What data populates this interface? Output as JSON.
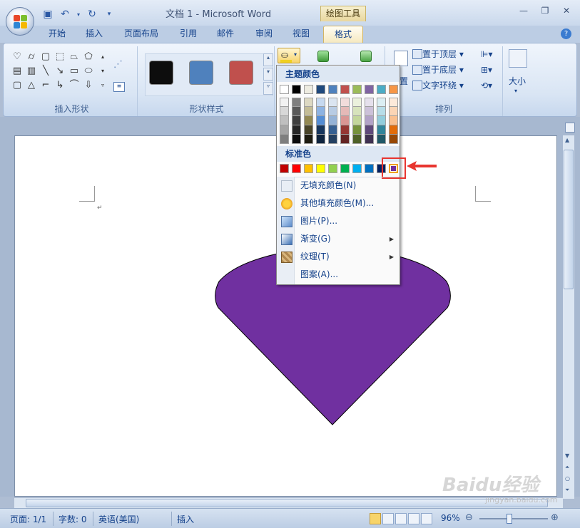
{
  "window": {
    "title": "文档 1 - Microsoft Word",
    "context_tab_group": "绘图工具"
  },
  "qat": {
    "icons": [
      "save-icon",
      "undo-icon",
      "redo-icon",
      "customize-icon"
    ]
  },
  "ribbon_tabs": [
    "开始",
    "插入",
    "页面布局",
    "引用",
    "邮件",
    "审阅",
    "视图",
    "格式"
  ],
  "active_tab": "格式",
  "groups": {
    "insert_shapes": "插入形状",
    "shape_styles": "形状样式",
    "arrange": "排列",
    "size": "大小"
  },
  "shape_style_swatches": [
    "#0d0d0d",
    "#4f81bd",
    "#c0504d"
  ],
  "arrange_items": [
    "置于顶层",
    "置于底层",
    "文字环绕"
  ],
  "arrange_partial_label": "置",
  "fill_dropdown": {
    "theme_colors_header": "主题颜色",
    "standard_colors_header": "标准色",
    "theme_top_row": [
      "#ffffff",
      "#000000",
      "#eeece1",
      "#1f497d",
      "#4f81bd",
      "#c0504d",
      "#9bbb59",
      "#8064a2",
      "#4bacc6",
      "#f79646"
    ],
    "theme_shades": [
      [
        "#f2f2f2",
        "#7f7f7f",
        "#ddd9c3",
        "#c6d9f0",
        "#dbe5f1",
        "#f2dcdb",
        "#ebf1dd",
        "#e5e0ec",
        "#dbeef3",
        "#fdeada"
      ],
      [
        "#d8d8d8",
        "#595959",
        "#c4bd97",
        "#8db3e2",
        "#b8cce4",
        "#e5b9b7",
        "#d7e3bc",
        "#ccc1d9",
        "#b7dde8",
        "#fbd5b5"
      ],
      [
        "#bfbfbf",
        "#3f3f3f",
        "#938953",
        "#548dd4",
        "#95b3d7",
        "#d99694",
        "#c3d69b",
        "#b2a2c7",
        "#92cddc",
        "#fac08f"
      ],
      [
        "#a5a5a5",
        "#262626",
        "#494429",
        "#17365d",
        "#366092",
        "#953734",
        "#76923c",
        "#5f497a",
        "#31859b",
        "#e36c09"
      ],
      [
        "#7f7f7f",
        "#0c0c0c",
        "#1d1b10",
        "#0f243e",
        "#244061",
        "#632423",
        "#4f6128",
        "#3f3151",
        "#205867",
        "#974806"
      ]
    ],
    "standard_colors": [
      "#c00000",
      "#ff0000",
      "#ffc000",
      "#ffff00",
      "#92d050",
      "#00b050",
      "#00b0f0",
      "#0070c0",
      "#002060",
      "#7030a0"
    ],
    "selected_standard_index": 9,
    "menu_items": [
      {
        "label": "无填充颜色(N)",
        "icon": "no-fill-icon",
        "submenu": false
      },
      {
        "label": "其他填充颜色(M)...",
        "icon": "color-palette-icon",
        "submenu": false
      },
      {
        "label": "图片(P)...",
        "icon": "picture-icon",
        "submenu": false
      },
      {
        "label": "渐变(G)",
        "icon": "gradient-icon",
        "submenu": true
      },
      {
        "label": "纹理(T)",
        "icon": "texture-icon",
        "submenu": true
      },
      {
        "label": "图案(A)...",
        "icon": "pattern-icon",
        "submenu": false
      }
    ]
  },
  "document": {
    "shape_fill": "#7030a0",
    "shape": "heart-like shape"
  },
  "statusbar": {
    "page": "页面: 1/1",
    "words": "字数: 0",
    "language": "英语(美国)",
    "mode": "插入",
    "zoom": "96%"
  },
  "watermark": {
    "logo": "Baidu经验",
    "url": "jingyan.baidu.com"
  }
}
